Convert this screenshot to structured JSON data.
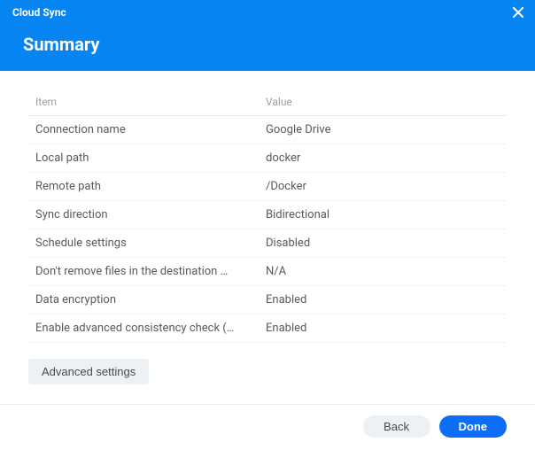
{
  "window": {
    "title": "Cloud Sync",
    "page_title": "Summary"
  },
  "table": {
    "headers": {
      "item": "Item",
      "value": "Value"
    },
    "rows": [
      {
        "item": "Connection name",
        "value": "Google Drive"
      },
      {
        "item": "Local path",
        "value": "docker"
      },
      {
        "item": "Remote path",
        "value": "/Docker"
      },
      {
        "item": "Sync direction",
        "value": "Bidirectional"
      },
      {
        "item": "Schedule settings",
        "value": "Disabled"
      },
      {
        "item": "Don't remove files in the destination …",
        "value": "N/A"
      },
      {
        "item": "Data encryption",
        "value": "Enabled"
      },
      {
        "item": "Enable advanced consistency check (…",
        "value": "Enabled"
      }
    ]
  },
  "buttons": {
    "advanced": "Advanced settings",
    "back": "Back",
    "done": "Done"
  }
}
